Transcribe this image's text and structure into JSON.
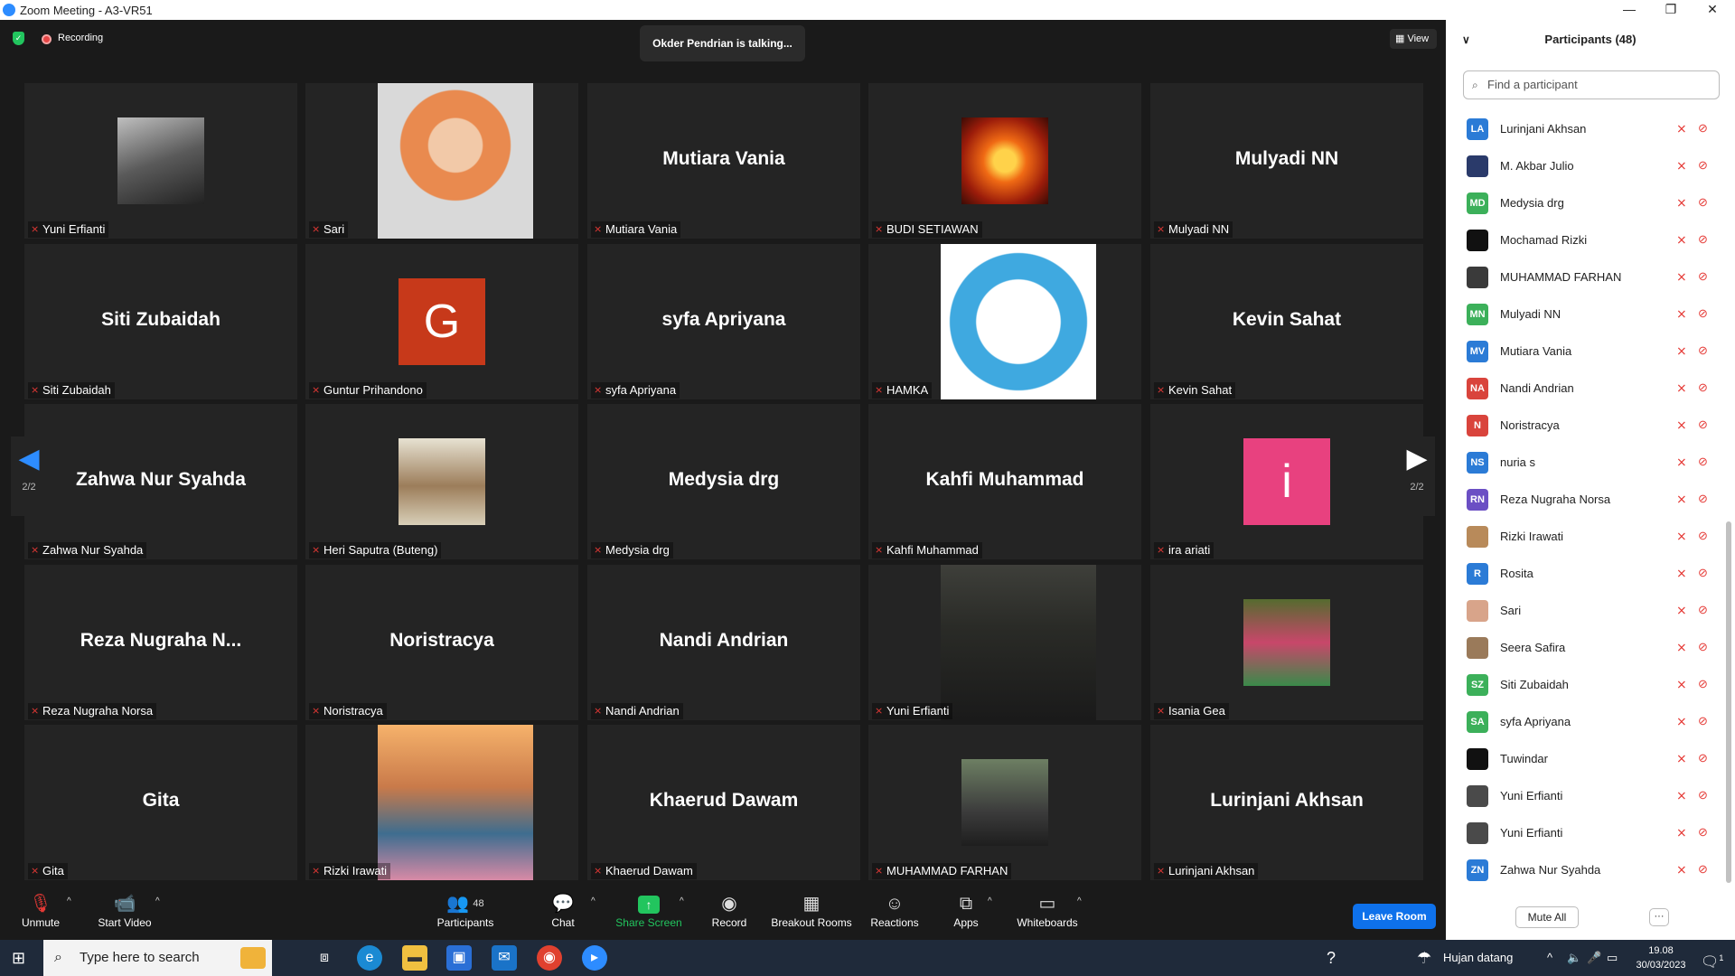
{
  "window": {
    "title": "Zoom Meeting - A3-VR51"
  },
  "topbar": {
    "recording": "Recording",
    "talking": "Okder Pendrian is talking...",
    "view": "View"
  },
  "tiles": [
    {
      "label": "Yuni Erfianti",
      "kind": "photo",
      "image": "hooded-figure"
    },
    {
      "label": "Sari",
      "kind": "photo",
      "image": "woman-hijab-orange"
    },
    {
      "label": "Mutiara Vania",
      "name": "Mutiara Vania",
      "kind": "name"
    },
    {
      "label": "BUDI SETIAWAN",
      "kind": "photo",
      "image": "fire-mask"
    },
    {
      "label": "Mulyadi NN",
      "name": "Mulyadi NN",
      "kind": "name"
    },
    {
      "label": "Siti Zubaidah",
      "name": "Siti Zubaidah",
      "kind": "name"
    },
    {
      "label": "Guntur Prihandono",
      "letter": "G",
      "kind": "letter",
      "color": "#c7391a"
    },
    {
      "label": "syfa Apriyana",
      "name": "syfa Apriyana",
      "kind": "name"
    },
    {
      "label": "HAMKA",
      "kind": "photo",
      "image": "bisameo-10th-anniversary-logo"
    },
    {
      "label": "Kevin Sahat",
      "name": "Kevin Sahat",
      "kind": "name"
    },
    {
      "label": "Zahwa Nur Syahda",
      "name": "Zahwa Nur Syahda",
      "kind": "name"
    },
    {
      "label": "Heri Saputra (Buteng)",
      "kind": "photo",
      "image": "stairway"
    },
    {
      "label": "Medysia drg",
      "name": "Medysia drg",
      "kind": "name"
    },
    {
      "label": "Kahfi Muhammad",
      "name": "Kahfi Muhammad",
      "kind": "name"
    },
    {
      "label": "ira ariati",
      "letter": "i",
      "kind": "letter",
      "color": "#e8417f"
    },
    {
      "label": "Reza Nugraha Norsa",
      "name": "Reza Nugraha N...",
      "kind": "name"
    },
    {
      "label": "Noristracya",
      "name": "Noristracya",
      "kind": "name"
    },
    {
      "label": "Nandi Andrian",
      "name": "Nandi Andrian",
      "kind": "name"
    },
    {
      "label": "Yuni Erfianti",
      "kind": "photo",
      "image": "woman-webcam"
    },
    {
      "label": "Isania Gea",
      "kind": "photo",
      "image": "cartoon-doll"
    },
    {
      "label": "Gita",
      "name": "Gita",
      "kind": "name"
    },
    {
      "label": "Rizki Irawati",
      "kind": "photo",
      "image": "woman-sunset-sea"
    },
    {
      "label": "Khaerud Dawam",
      "name": "Khaerud Dawam",
      "kind": "name"
    },
    {
      "label": "MUHAMMAD FARHAN",
      "kind": "photo",
      "image": "man-glasses"
    },
    {
      "label": "Lurinjani Akhsan",
      "name": "Lurinjani Akhsan",
      "kind": "name"
    }
  ],
  "nav": {
    "left_page": "2/2",
    "right_page": "2/2"
  },
  "toolbar": {
    "unmute": "Unmute",
    "start_video": "Start Video",
    "participants_count": "48",
    "participants": "Participants",
    "chat": "Chat",
    "share_screen": "Share Screen",
    "record": "Record",
    "breakout": "Breakout Rooms",
    "reactions": "Reactions",
    "apps": "Apps",
    "whiteboards": "Whiteboards",
    "leave": "Leave Room"
  },
  "panel": {
    "title": "Participants (48)",
    "search_placeholder": "Find a participant",
    "mute_all": "Mute All",
    "more": "···",
    "participants": [
      {
        "name": "Lurinjani Akhsan",
        "initials": "LA",
        "color": "#2b7bd6"
      },
      {
        "name": "M. Akbar Julio",
        "initials": "",
        "color": "#2a3a6a"
      },
      {
        "name": "Medysia drg",
        "initials": "MD",
        "color": "#3cb05a"
      },
      {
        "name": "Mochamad Rizki",
        "initials": "",
        "color": "#111111"
      },
      {
        "name": "MUHAMMAD FARHAN",
        "initials": "",
        "color": "#3a3a3a"
      },
      {
        "name": "Mulyadi NN",
        "initials": "MN",
        "color": "#3cb05a"
      },
      {
        "name": "Mutiara Vania",
        "initials": "MV",
        "color": "#2b7bd6"
      },
      {
        "name": "Nandi Andrian",
        "initials": "NA",
        "color": "#d9443c"
      },
      {
        "name": "Noristracya",
        "initials": "N",
        "color": "#d9443c"
      },
      {
        "name": "nuria s",
        "initials": "NS",
        "color": "#2b7bd6"
      },
      {
        "name": "Reza Nugraha Norsa",
        "initials": "RN",
        "color": "#6b4fc4"
      },
      {
        "name": "Rizki Irawati",
        "initials": "",
        "color": "#b88a5a"
      },
      {
        "name": "Rosita",
        "initials": "R",
        "color": "#2b7bd6"
      },
      {
        "name": "Sari",
        "initials": "",
        "color": "#d8a48a"
      },
      {
        "name": "Seera Safira",
        "initials": "",
        "color": "#9a7a5a"
      },
      {
        "name": "Siti Zubaidah",
        "initials": "SZ",
        "color": "#3cb05a"
      },
      {
        "name": "syfa Apriyana",
        "initials": "SA",
        "color": "#3cb05a"
      },
      {
        "name": "Tuwindar",
        "initials": "",
        "color": "#111111"
      },
      {
        "name": "Yuni Erfianti",
        "initials": "",
        "color": "#4a4a4a"
      },
      {
        "name": "Yuni Erfianti",
        "initials": "",
        "color": "#4a4a4a"
      },
      {
        "name": "Zahwa Nur Syahda",
        "initials": "ZN",
        "color": "#2b7bd6"
      }
    ]
  },
  "taskbar": {
    "search_placeholder": "Type here to search",
    "weather": "Hujan datang",
    "time": "19.08",
    "date": "30/03/2023",
    "notif_count": "1"
  }
}
